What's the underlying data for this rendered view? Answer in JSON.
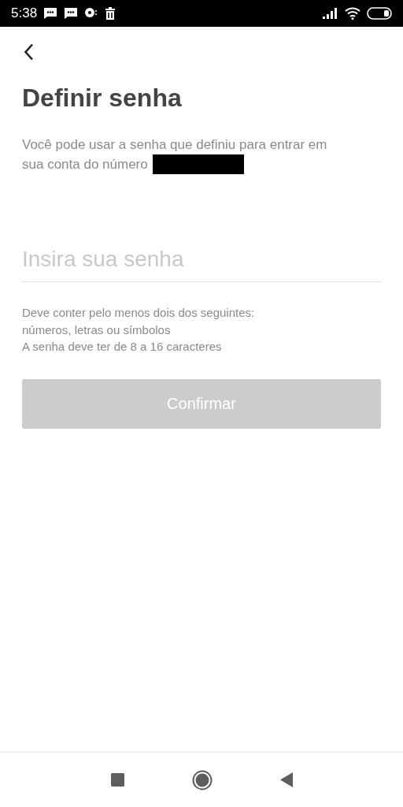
{
  "status_bar": {
    "time": "5:38"
  },
  "title": "Definir senha",
  "description": "Você pode usar a senha que definiu para entrar em sua conta do número",
  "password_field": {
    "placeholder": "Insira sua senha"
  },
  "hints": [
    "Deve conter pelo menos dois dos seguintes: números, letras ou símbolos",
    "A senha deve ter de 8 a 16 caracteres"
  ],
  "confirm_button": {
    "label": "Confirmar",
    "disabled": true
  }
}
